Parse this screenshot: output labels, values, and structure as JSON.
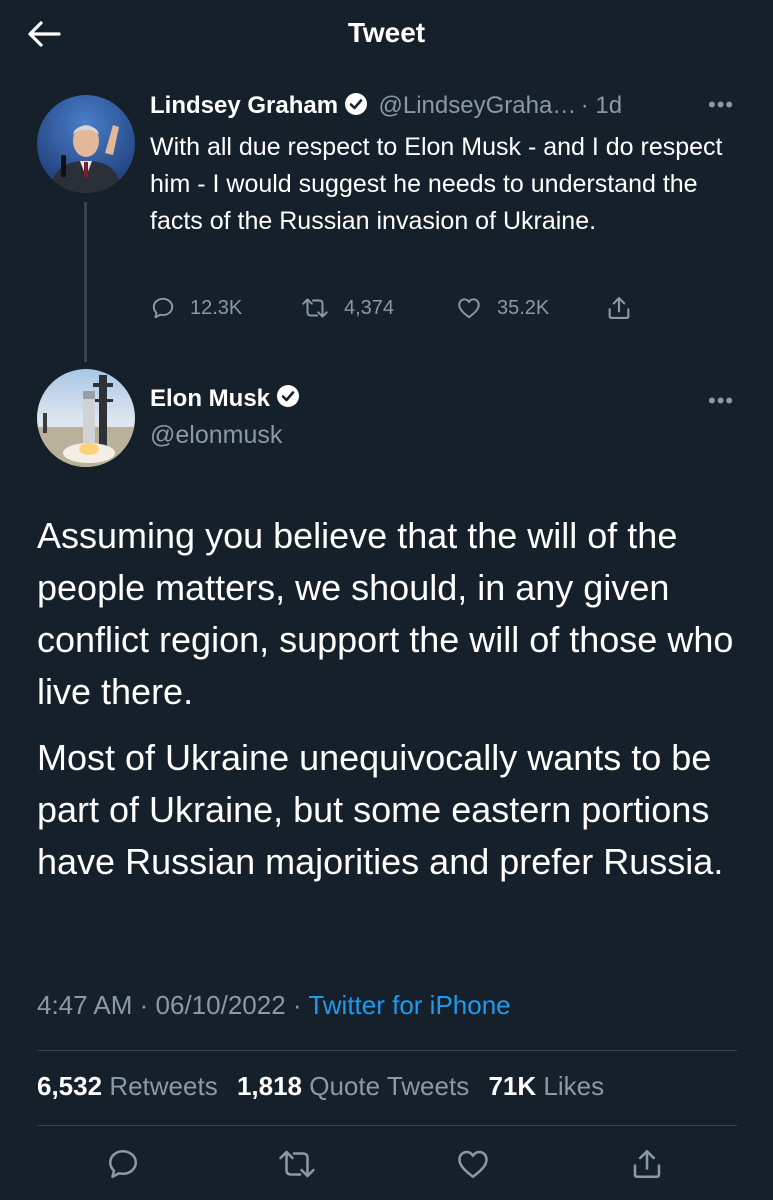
{
  "header": {
    "title": "Tweet"
  },
  "reply": {
    "name": "Lindsey Graham",
    "handle": "@LindseyGraha…",
    "time": "· 1d",
    "text": "With all due respect to Elon Musk - and I do respect him - I would suggest he needs to understand the facts of the Russian invasion of Ukraine.",
    "actions": {
      "replies": "12.3K",
      "retweets": "4,374",
      "likes": "35.2K"
    }
  },
  "tweet": {
    "name": "Elon Musk",
    "handle": "@elonmusk",
    "paragraphs": [
      "Assuming you believe that the will of the people matters, we should, in any given conflict region, support the will of those who live there.",
      "Most of Ukraine unequivocally wants to be part of Ukraine, but some eastern portions have Russian majorities and prefer Russia."
    ],
    "time": "4:47 AM",
    "date": "06/10/2022",
    "source": "Twitter for iPhone",
    "stats": {
      "retweets_count": "6,532",
      "retweets_label": "Retweets",
      "quotes_count": "1,818",
      "quotes_label": "Quote Tweets",
      "likes_count": "71K",
      "likes_label": "Likes"
    }
  },
  "colors": {
    "background": "#15202b",
    "secondary_text": "#8b98a5",
    "link": "#1d9bf0",
    "divider": "#38444d"
  }
}
